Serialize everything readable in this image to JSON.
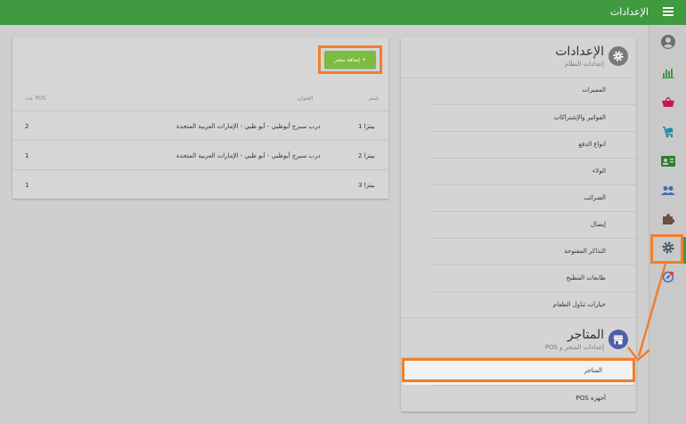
{
  "topbar": {
    "title": "الإعدادات",
    "menu_icon": "menu-icon",
    "bg": "#3f9a40"
  },
  "rail": {
    "items": [
      {
        "name": "account-icon",
        "glyph": "account",
        "color": "#6d6d6d"
      },
      {
        "name": "reports-icon",
        "glyph": "bars",
        "color": "#3f9a40"
      },
      {
        "name": "basket-icon",
        "glyph": "basket",
        "color": "#c2185b"
      },
      {
        "name": "cart-icon",
        "glyph": "cart",
        "color": "#1e88a8"
      },
      {
        "name": "contact-card-icon",
        "glyph": "card",
        "color": "#2e7d32"
      },
      {
        "name": "people-icon",
        "glyph": "people",
        "color": "#3b6fb6"
      },
      {
        "name": "puzzle-icon",
        "glyph": "puzzle",
        "color": "#6d4c41"
      },
      {
        "name": "gear-icon",
        "glyph": "gear",
        "color": "#455a64",
        "active": true
      },
      {
        "name": "compass-icon",
        "glyph": "compass",
        "color": "#3b6fb6"
      }
    ]
  },
  "settings_section": {
    "title": "الإعدادات",
    "subtitle": "إعدادات النظام",
    "items": [
      "المميزات",
      "الفواتير والإشتراكات",
      "انواع الدفع",
      "الولاء",
      "الضرائب",
      "إيصال",
      "التذاكر المفتوحة",
      "طابعات المطبخ",
      "خيارات تناول الطعام"
    ]
  },
  "stores_section": {
    "title": "المتاجر",
    "subtitle": "إعدادات المتجر و POS",
    "items": [
      "المتاجر",
      "أجهزة POS"
    ]
  },
  "stores_table": {
    "add_button": "+ إضافة متجر",
    "headers": {
      "name": "إسم",
      "address": "العنوان",
      "pos_count": "عدد POS"
    },
    "rows": [
      {
        "name": "بيتزا 1",
        "address": "درب سبرج أبوظبي - أبو ظبي - الإمارات العربية المتحدة",
        "pos_count": "2"
      },
      {
        "name": "بيتزا 2",
        "address": "درب سبرج أبوظبي - أبو ظبي - الإمارات العربية المتحدة",
        "pos_count": "1"
      },
      {
        "name": "بيتزا 3",
        "address": "",
        "pos_count": "1"
      }
    ]
  },
  "colors": {
    "highlight": "#ef7f2d",
    "add_button": "#7cbc3e",
    "accent_green": "#3f9a40"
  }
}
